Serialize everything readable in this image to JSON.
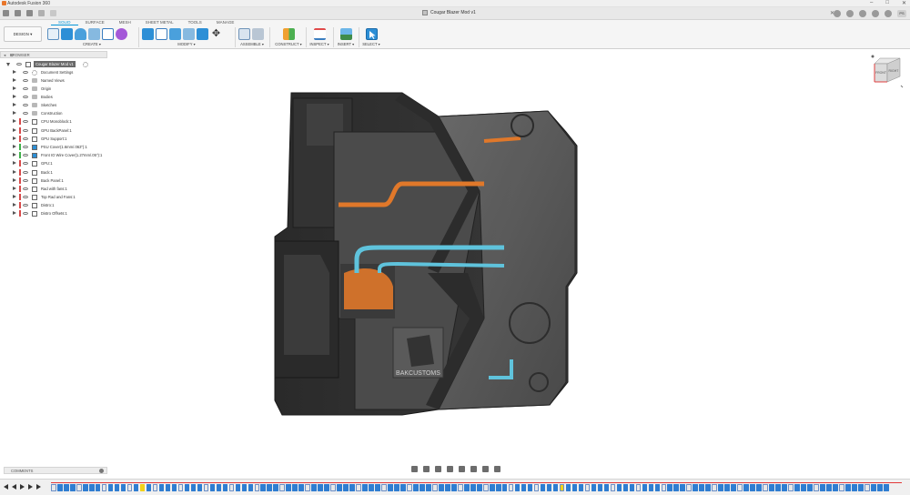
{
  "window": {
    "title": "Autodesk Fusion 360"
  },
  "document": {
    "tab_title": "Cougar Blazer Mod v1"
  },
  "workspace": {
    "label": "DESIGN ▾"
  },
  "ribbon": {
    "tabs": [
      {
        "label": "SOLID",
        "active": true
      },
      {
        "label": "SURFACE"
      },
      {
        "label": "MESH"
      },
      {
        "label": "SHEET METAL"
      },
      {
        "label": "TOOLS"
      },
      {
        "label": "MANAGE"
      }
    ],
    "groups": {
      "create": "CREATE ▾",
      "modify": "MODIFY ▾",
      "assemble": "ASSEMBLE ▾",
      "construct": "CONSTRUCT ▾",
      "inspect": "INSPECT ▾",
      "insert": "INSERT ▾",
      "select": "SELECT ▾"
    }
  },
  "browser": {
    "header": "BROWSER",
    "root": "Cougar Blazer Mod v1",
    "items": [
      {
        "label": "Document Settings",
        "icon": "gear"
      },
      {
        "label": "Named Views",
        "icon": "folder"
      },
      {
        "label": "Origin",
        "icon": "folder"
      },
      {
        "label": "Bodies",
        "icon": "folder"
      },
      {
        "label": "Sketches",
        "icon": "folder"
      },
      {
        "label": "Construction",
        "icon": "folder"
      },
      {
        "label": "CPU Monoblock:1",
        "icon": "comp",
        "color": "#d84a4a"
      },
      {
        "label": "GPU BackPanel:1",
        "icon": "comp",
        "color": "#d84a4a"
      },
      {
        "label": "GPU Support:1",
        "icon": "comp",
        "color": "#d84a4a"
      },
      {
        "label": "PSU Cover(1.6mm/.063\"):1",
        "icon": "comp-blue",
        "color": "#3fb04a"
      },
      {
        "label": "Front IO Wire Cover(1.27mm/.05\"):1",
        "icon": "comp-blue",
        "color": "#3fb04a"
      },
      {
        "label": "GPU:1",
        "icon": "comp",
        "color": "#d84a4a"
      },
      {
        "label": "Back:1",
        "icon": "comp",
        "color": "#d84a4a"
      },
      {
        "label": "Back Panel:1",
        "icon": "comp",
        "color": "#d84a4a"
      },
      {
        "label": "Rad with fans:1",
        "icon": "comp",
        "color": "#d84a4a"
      },
      {
        "label": "Top Rad and Fans:1",
        "icon": "comp",
        "color": "#d84a4a"
      },
      {
        "label": "Distro:1",
        "icon": "comp",
        "color": "#d84a4a"
      },
      {
        "label": "Distro Offsets:1",
        "icon": "comp",
        "color": "#d84a4a"
      }
    ]
  },
  "viewport": {
    "logo_text": "BAKCUSTOMS"
  },
  "viewcube": {
    "front": "FRONT",
    "right": "RIGHT"
  },
  "comments": {
    "label": "COMMENTS"
  },
  "user": {
    "initials": "PS"
  },
  "colors": {
    "accent": "#0696d7",
    "timeline_feature": "#2f7dd1",
    "timeline_marker": "#e23a3a"
  }
}
